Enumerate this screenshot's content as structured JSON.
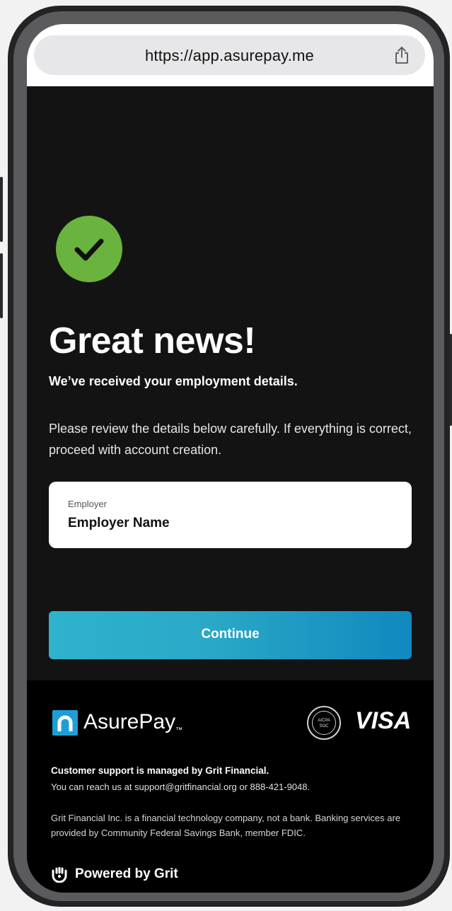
{
  "browser": {
    "url": "https://app.asurepay.me"
  },
  "main": {
    "headline": "Great news!",
    "subheadline": "We’ve received your employment details.",
    "instructions": "Please review the details below carefully. If everything is correct, proceed with account creation.",
    "employer_field": {
      "label": "Employer",
      "value": "Employer Name"
    },
    "continue_label": "Continue"
  },
  "footer": {
    "brand_name": "AsurePay",
    "brand_tm": "™",
    "soc_badge_text_top": "AICPA",
    "soc_badge_text_bottom": "SOC",
    "card_network": "VISA",
    "support_title": "Customer support is managed by Grit Financial.",
    "support_contact": "You can reach us at support@gritfinancial.org or 888-421-9048.",
    "disclaimer": "Grit Financial Inc. is a financial technology company, not a bank. Banking services are provided by Community Federal Savings Bank, member FDIC.",
    "powered_by": "Powered by Grit"
  },
  "colors": {
    "success_green": "#6ab33e",
    "continue_gradient_start": "#2fb3cd",
    "continue_gradient_end": "#1188bf",
    "brand_blue": "#1d9fd6",
    "screen_background": "#131313"
  },
  "icons": {
    "success": "checkmark-circle-icon",
    "share": "share-icon",
    "brand": "asurepay-logo-icon",
    "powered": "grit-logo-icon"
  }
}
